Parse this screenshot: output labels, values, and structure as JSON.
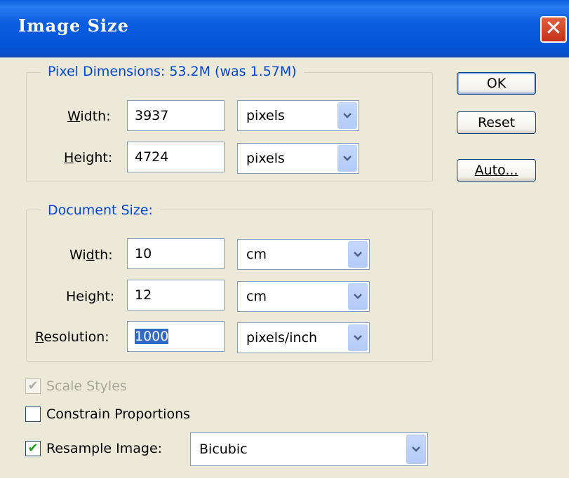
{
  "window": {
    "title": "Image Size",
    "close_symbol": "✕"
  },
  "pixel_dimensions": {
    "legend": "Pixel Dimensions:  53.2M (was 1.57M)",
    "width": {
      "label": "Width:",
      "value": "3937",
      "unit": "pixels"
    },
    "height": {
      "label": "Height:",
      "value": "4724",
      "unit": "pixels"
    }
  },
  "document_size": {
    "legend": "Document Size:",
    "width": {
      "label": "Width:",
      "value": "10",
      "unit": "cm"
    },
    "height": {
      "label": "Height:",
      "value": "12",
      "unit": "cm"
    },
    "resolution": {
      "label": "Resolution:",
      "value": "1000",
      "unit": "pixels/inch"
    }
  },
  "buttons": {
    "ok": "OK",
    "reset": "Reset",
    "auto": "Auto..."
  },
  "options": {
    "scale_styles": {
      "label": "Scale Styles",
      "checked": true,
      "enabled": false
    },
    "constrain_proportions": {
      "label": "Constrain Proportions",
      "checked": false
    },
    "resample_image": {
      "label": "Resample Image:",
      "checked": true,
      "method": "Bicubic"
    }
  },
  "icons": {
    "checkmark": "✔",
    "dropdown": "chevron-down-icon"
  }
}
